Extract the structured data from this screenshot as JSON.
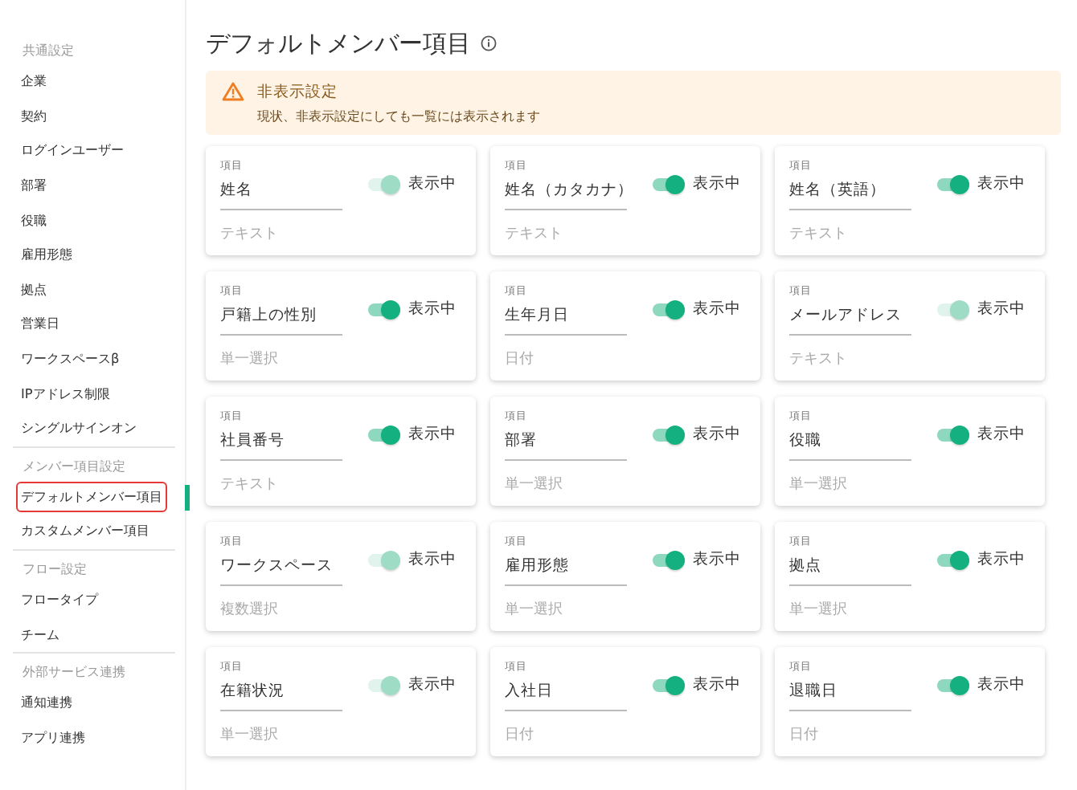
{
  "sidebar": {
    "sections": [
      {
        "heading": "共通設定",
        "items": [
          {
            "label": "企業",
            "selected": false
          },
          {
            "label": "契約",
            "selected": false
          },
          {
            "label": "ログインユーザー",
            "selected": false
          },
          {
            "label": "部署",
            "selected": false
          },
          {
            "label": "役職",
            "selected": false
          },
          {
            "label": "雇用形態",
            "selected": false
          },
          {
            "label": "拠点",
            "selected": false
          },
          {
            "label": "営業日",
            "selected": false
          },
          {
            "label": "ワークスペースβ",
            "selected": false
          },
          {
            "label": "IPアドレス制限",
            "selected": false
          },
          {
            "label": "シングルサインオン",
            "selected": false
          }
        ]
      },
      {
        "heading": "メンバー項目設定",
        "items": [
          {
            "label": "デフォルトメンバー項目",
            "selected": true
          },
          {
            "label": "カスタムメンバー項目",
            "selected": false
          }
        ]
      },
      {
        "heading": "フロー設定",
        "items": [
          {
            "label": "フロータイプ",
            "selected": false
          },
          {
            "label": "チーム",
            "selected": false
          }
        ]
      },
      {
        "heading": "外部サービス連携",
        "items": [
          {
            "label": "通知連携",
            "selected": false
          },
          {
            "label": "アプリ連携",
            "selected": false
          }
        ]
      }
    ]
  },
  "page": {
    "title": "デフォルトメンバー項目"
  },
  "alert": {
    "title": "非表示設定",
    "message": "現状、非表示設定にしても一覧には表示されます"
  },
  "fields": [
    {
      "caption": "項目",
      "name": "姓名",
      "on": true,
      "disabled": true,
      "toggle_label": "表示中",
      "type": "テキスト"
    },
    {
      "caption": "項目",
      "name": "姓名（カタカナ）",
      "on": true,
      "disabled": false,
      "toggle_label": "表示中",
      "type": "テキスト"
    },
    {
      "caption": "項目",
      "name": "姓名（英語）",
      "on": true,
      "disabled": false,
      "toggle_label": "表示中",
      "type": "テキスト"
    },
    {
      "caption": "項目",
      "name": "戸籍上の性別",
      "on": true,
      "disabled": false,
      "toggle_label": "表示中",
      "type": "単一選択"
    },
    {
      "caption": "項目",
      "name": "生年月日",
      "on": true,
      "disabled": false,
      "toggle_label": "表示中",
      "type": "日付"
    },
    {
      "caption": "項目",
      "name": "メールアドレス",
      "on": true,
      "disabled": true,
      "toggle_label": "表示中",
      "type": "テキスト"
    },
    {
      "caption": "項目",
      "name": "社員番号",
      "on": true,
      "disabled": false,
      "toggle_label": "表示中",
      "type": "テキスト"
    },
    {
      "caption": "項目",
      "name": "部署",
      "on": true,
      "disabled": false,
      "toggle_label": "表示中",
      "type": "単一選択"
    },
    {
      "caption": "項目",
      "name": "役職",
      "on": true,
      "disabled": false,
      "toggle_label": "表示中",
      "type": "単一選択"
    },
    {
      "caption": "項目",
      "name": "ワークスペース",
      "on": true,
      "disabled": true,
      "toggle_label": "表示中",
      "type": "複数選択"
    },
    {
      "caption": "項目",
      "name": "雇用形態",
      "on": true,
      "disabled": false,
      "toggle_label": "表示中",
      "type": "単一選択"
    },
    {
      "caption": "項目",
      "name": "拠点",
      "on": true,
      "disabled": false,
      "toggle_label": "表示中",
      "type": "単一選択"
    },
    {
      "caption": "項目",
      "name": "在籍状況",
      "on": true,
      "disabled": true,
      "toggle_label": "表示中",
      "type": "単一選択"
    },
    {
      "caption": "項目",
      "name": "入社日",
      "on": true,
      "disabled": false,
      "toggle_label": "表示中",
      "type": "日付"
    },
    {
      "caption": "項目",
      "name": "退職日",
      "on": true,
      "disabled": false,
      "toggle_label": "表示中",
      "type": "日付"
    }
  ]
}
